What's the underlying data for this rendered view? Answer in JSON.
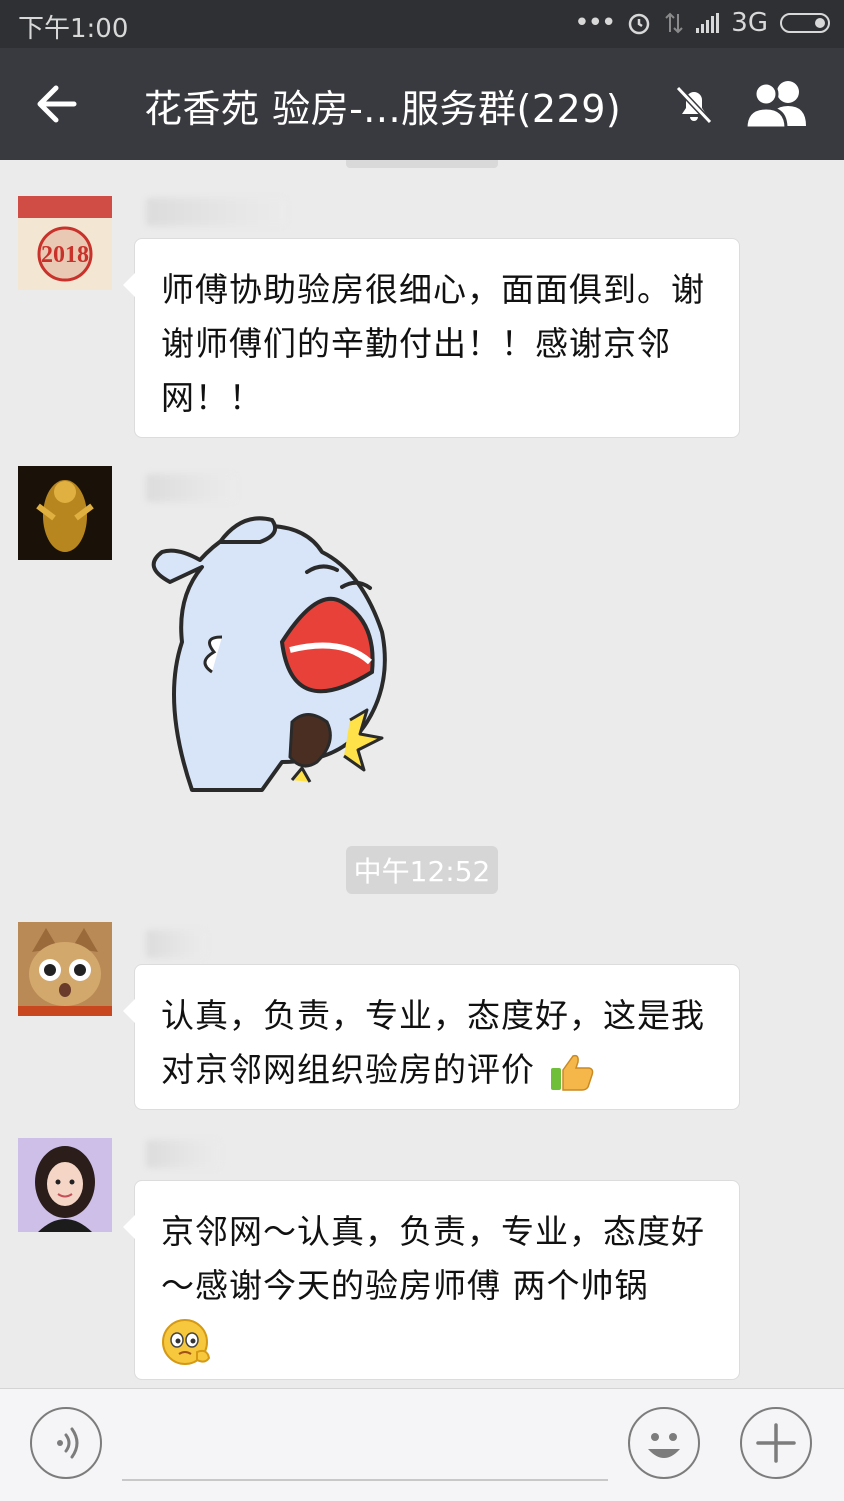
{
  "status_bar": {
    "time": "下午1:00",
    "network": "3G"
  },
  "header": {
    "title": "花香苑 验房-...服务群(229)"
  },
  "messages": [
    {
      "type": "text",
      "text": "师傅协助验房很细心，面面俱到。谢谢师傅们的辛勤付出！！感谢京邻网！！"
    },
    {
      "type": "sticker",
      "sticker": "laughing-clapping-cartoon"
    },
    {
      "type": "timestamp",
      "text": "中午12:52"
    },
    {
      "type": "text",
      "text": "认真，负责，专业，态度好，这是我对京邻网组织验房的评价",
      "emoji": "thumbs-up"
    },
    {
      "type": "text",
      "text": "京邻网～认真，负责，专业，态度好～感谢今天的验房师傅 两个帅锅",
      "emoji": "shy-face"
    }
  ],
  "icons": {
    "back": "back-arrow-icon",
    "mute": "bell-muted-icon",
    "members": "group-members-icon",
    "voice": "voice-input-icon",
    "emoji": "emoji-icon",
    "more": "plus-icon"
  },
  "colors": {
    "header_bg": "#393a3f",
    "chat_bg": "#ebebeb",
    "bubble": "#ffffff"
  }
}
